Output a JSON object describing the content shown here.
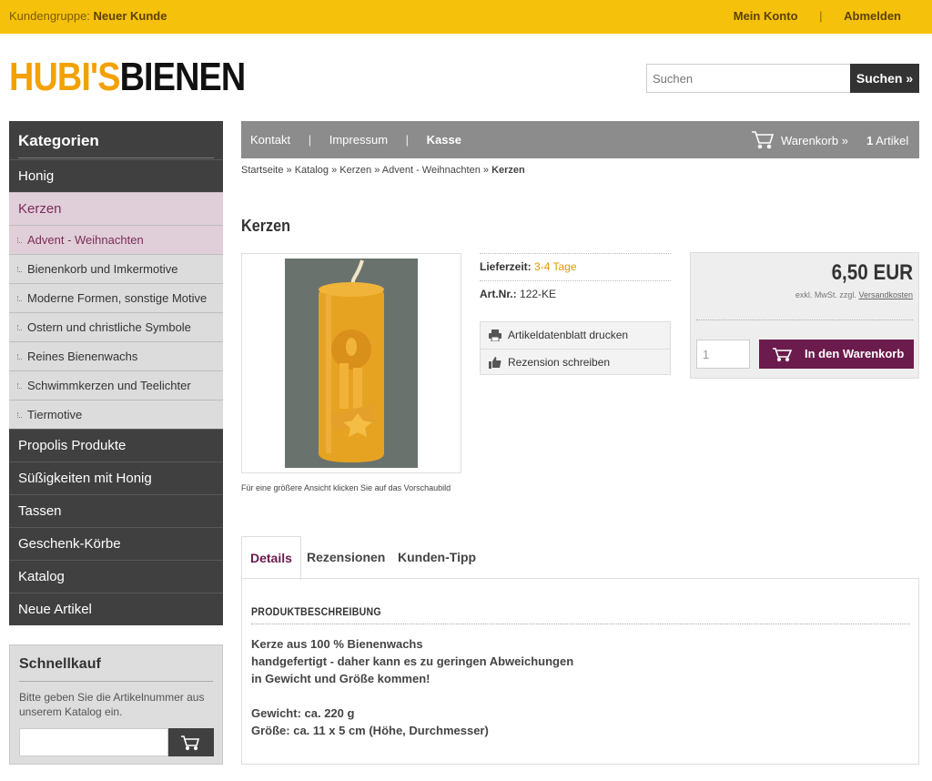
{
  "topbar": {
    "group_label": "Kundengruppe:",
    "group_value": "Neuer Kunde",
    "account": "Mein Konto",
    "separator": "|",
    "logout": "Abmelden"
  },
  "logo": {
    "part1": "HUBI'S",
    "part2": "BIENEN"
  },
  "search": {
    "placeholder": "Suchen",
    "button": "Suchen »"
  },
  "sidebar": {
    "title": "Kategorien",
    "items": [
      {
        "label": "Honig"
      },
      {
        "label": "Kerzen"
      },
      {
        "label": "Advent - Weihnachten"
      },
      {
        "label": "Bienenkorb und Imkermotive"
      },
      {
        "label": "Moderne Formen, sonstige Motive"
      },
      {
        "label": "Ostern und christliche Symbole"
      },
      {
        "label": "Reines Bienenwachs"
      },
      {
        "label": "Schwimmkerzen und Teelichter"
      },
      {
        "label": "Tiermotive"
      },
      {
        "label": "Propolis Produkte"
      },
      {
        "label": "Süßigkeiten mit Honig"
      },
      {
        "label": "Tassen"
      },
      {
        "label": "Geschenk-Körbe"
      },
      {
        "label": "Katalog"
      },
      {
        "label": "Neue Artikel"
      }
    ]
  },
  "quick": {
    "title": "Schnellkauf",
    "text": "Bitte geben Sie die Artikelnummer aus unserem Katalog ein."
  },
  "nav": {
    "contact": "Kontakt",
    "imprint": "Impressum",
    "checkout": "Kasse",
    "sep": "|",
    "cart": "Warenkorb »",
    "count": "1",
    "count_label": "Artikel"
  },
  "breadcrumb": {
    "items": [
      "Startseite",
      "Katalog",
      "Kerzen",
      "Advent - Weihnachten"
    ],
    "sep": "»",
    "current": "Kerzen"
  },
  "product": {
    "title": "Kerzen",
    "image_caption": "Für eine größere Ansicht klicken Sie auf das Vorschaubild",
    "delivery_label": "Lieferzeit:",
    "delivery_value": "3-4 Tage",
    "art_label": "Art.Nr.:",
    "art_value": "122-KE",
    "print": "Artikeldatenblatt drucken",
    "review": "Rezension schreiben",
    "price": "6,50 EUR",
    "tax_text": "exkl. MwSt. zzgl.",
    "shipping": "Versandkosten",
    "qty": "1",
    "add_to_cart": "In den Warenkorb »"
  },
  "tabs": {
    "details": "Details",
    "reviews": "Rezensionen",
    "tip": "Kunden-Tipp"
  },
  "description": {
    "heading": "PRODUKTBESCHREIBUNG",
    "line1": "Kerze aus 100 % Bienenwachs",
    "line2": "handgefertigt - daher kann es zu geringen Abweichungen",
    "line3": "in Gewicht und Größe kommen!",
    "line4": "Gewicht: ca. 220 g",
    "line5": "Größe: ca. 11 x 5 cm (Höhe, Durchmesser)"
  },
  "colors": {
    "topbar": "#f6c10a",
    "accent": "#6b1b4c",
    "orange": "#e09800"
  }
}
